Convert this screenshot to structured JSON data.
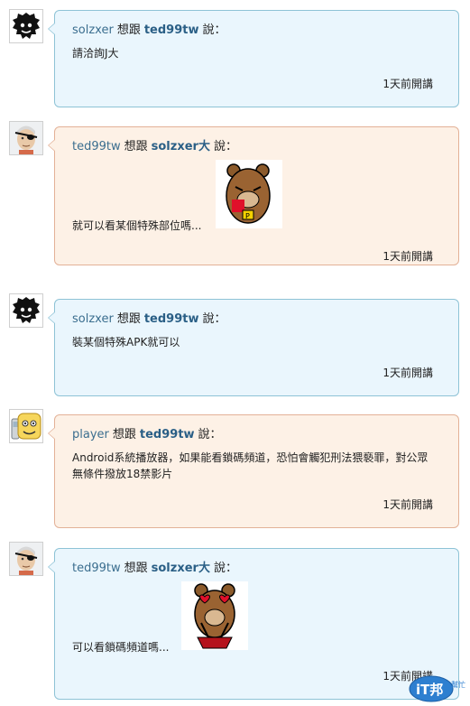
{
  "messages": [
    {
      "user": "solzxer",
      "verb": "想跟",
      "target": "ted99tw",
      "said": "說：",
      "text": "請洽詢J大",
      "time": "1天前開講",
      "avatar": "black-shadow-avatar",
      "theme": "blue"
    },
    {
      "user": "ted99tw",
      "verb": "想跟",
      "target": "solzxer大",
      "said": "說：",
      "text": "就可以看某個特殊部位嗎...",
      "time": "1天前開講",
      "avatar": "eye-patch-man-avatar",
      "theme": "peach",
      "sticker": "bear-nosebleed-sticker"
    },
    {
      "user": "solzxer",
      "verb": "想跟",
      "target": "ted99tw",
      "said": "說：",
      "text": "裝某個特殊APK就可以",
      "time": "1天前開講",
      "avatar": "black-shadow-avatar",
      "theme": "blue"
    },
    {
      "user": "player",
      "verb": "想跟",
      "target": "ted99tw",
      "said": "說：",
      "text": "Android系統播放器，如果能看鎖碼頻道，恐怕會觸犯刑法猥褻罪，對公眾無條件撥放18禁影片",
      "time": "1天前開講",
      "avatar": "cartoon-face-avatar",
      "theme": "peach"
    },
    {
      "user": "ted99tw",
      "verb": "想跟",
      "target": "solzxer大",
      "said": "說：",
      "text": "可以看鎖碼頻道嗎...",
      "time": "1天前開講",
      "avatar": "eye-patch-man-avatar",
      "theme": "blue",
      "sticker": "bear-heart-eyes-sticker"
    }
  ],
  "watermark": {
    "logo_text": "iT邦",
    "logo_sub": "幫忙"
  },
  "colors": {
    "blue_bg": "#eaf6fd",
    "blue_border": "#8ec3d6",
    "peach_bg": "#fdf1e6",
    "peach_border": "#e3b197",
    "name": "#3b6e8f"
  }
}
